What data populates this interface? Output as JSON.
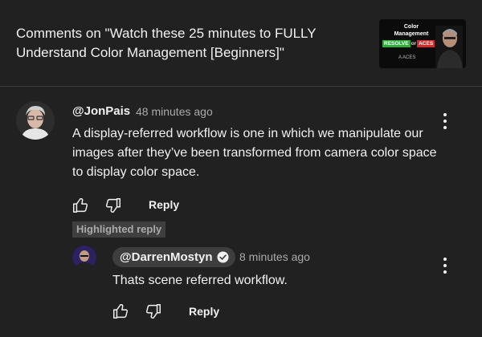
{
  "header": {
    "title": "Comments on \"Watch these 25 minutes to FULLY Understand Color Management [Beginners]\"",
    "thumbnail": {
      "line1": "Color",
      "line2": "Management",
      "resolve": "RESOLVE",
      "or": "or",
      "aces": "ACES",
      "question": "?",
      "logos": "A  ACES",
      "resolve_color": "#2fae3c",
      "aces_color": "#d42a2a"
    }
  },
  "comment": {
    "author": "@JonPais",
    "time": "48 minutes ago",
    "text": "A display-referred workflow is one in which we manipulate our images after they’ve been transformed from camera color space to display color space.",
    "reply_label": "Reply",
    "highlight_label": "Highlighted reply"
  },
  "reply": {
    "author": "@DarrenMostyn",
    "time": "8 minutes ago",
    "text": "Thats scene referred workflow.",
    "reply_label": "Reply"
  },
  "icons": {
    "like": "thumbs-up-icon",
    "dislike": "thumbs-down-icon",
    "menu": "more-vert-icon",
    "verified": "checkmark-badge-icon"
  }
}
